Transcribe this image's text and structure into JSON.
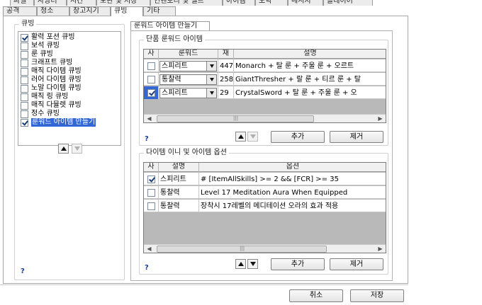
{
  "top_tabs_row1": [
    "파일",
    "사냥터",
    "시간",
    "보관 및 저장",
    "인벤토리 및 벨트",
    "아이템",
    "도박",
    "메시지",
    "플레이어"
  ],
  "top_tabs_row2": [
    "공격",
    "청소",
    "창고지기",
    "큐빙",
    "기타"
  ],
  "active_tab": "큐빙",
  "left_group": {
    "title": "큐빙",
    "items": [
      {
        "label": "활력 포션 큐빙",
        "checked": true,
        "selected": false
      },
      {
        "label": "보석 큐빙",
        "checked": false,
        "selected": false
      },
      {
        "label": "룬 큐빙",
        "checked": false,
        "selected": false
      },
      {
        "label": "크래프트 큐빙",
        "checked": false,
        "selected": false
      },
      {
        "label": "매직 다이템 큐빙",
        "checked": false,
        "selected": false
      },
      {
        "label": "러어 다이템 큐빙",
        "checked": false,
        "selected": false
      },
      {
        "label": "노말 다이템 큐빙",
        "checked": false,
        "selected": false
      },
      {
        "label": "매직 링 큐빙",
        "checked": false,
        "selected": false
      },
      {
        "label": "매직 다뮬렛 큐빙",
        "checked": false,
        "selected": false
      },
      {
        "label": "정수 큐빙",
        "checked": false,
        "selected": false
      },
      {
        "label": "룬워드 아이템 만들기",
        "checked": true,
        "selected": true
      }
    ],
    "help": "?"
  },
  "subtab": "룬워드 아이템 만들기",
  "runeword_group": {
    "title": "단품 룬워드 아이템",
    "columns": [
      "사",
      "룬워드",
      "재",
      "설명"
    ],
    "rows": [
      {
        "checked": false,
        "runeword": "스피리트",
        "num": "447",
        "desc": "Monarch + 탈 룬 + 주울 룬 + 오르트"
      },
      {
        "checked": false,
        "runeword": "통찰력",
        "num": "258",
        "desc": "GiantThresher + 랄 룬 + 티르 룬 + 탈"
      },
      {
        "checked": true,
        "runeword": "스피리트",
        "num": "29",
        "desc": "CrystalSword + 탈 룬 + 주울 룬 + 오"
      }
    ],
    "help": "?",
    "add_label": "추가",
    "remove_label": "제거"
  },
  "option_group": {
    "title": "다이템 이니 및 아이템 옵션",
    "columns": [
      "사",
      "설명",
      "옵션"
    ],
    "rows": [
      {
        "checked": true,
        "name": "스피리트",
        "option": "# [ItemAllSkills] >= 2 && [FCR] >= 35"
      },
      {
        "checked": false,
        "name": "통찰력",
        "option": "Level 17 Meditation Aura When Equipped"
      },
      {
        "checked": false,
        "name": "통찰력",
        "option": "장착시 17레벨의 메디테이션 오라의 효과 적용"
      }
    ],
    "help": "?",
    "add_label": "추가",
    "remove_label": "제거"
  },
  "footer": {
    "cancel_label": "취소",
    "save_label": "저장"
  }
}
